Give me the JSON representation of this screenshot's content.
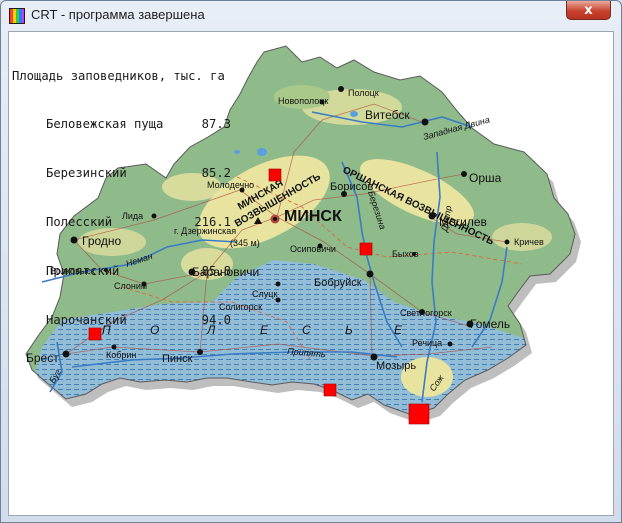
{
  "window": {
    "title": "CRT - программа завершена",
    "close_glyph": "x",
    "icon": "crt-program-icon"
  },
  "console": {
    "heading": "Площадь заповедников, тыс. га",
    "rows": [
      {
        "name": "Беловежская пуща",
        "value": "87.3"
      },
      {
        "name": "Березинский",
        "value": "85.2"
      },
      {
        "name": "Полесский",
        "value": "216.1"
      },
      {
        "name": "Припятский",
        "value": "85.8"
      },
      {
        "name": "Нарочанский",
        "value": "94.0"
      }
    ]
  },
  "map": {
    "colors": {
      "lowland": "#8fba8a",
      "upland": "#e8e4a0",
      "polesie": "#93bcd7",
      "rivers": "#3a7cc4",
      "marker": "#ff0000"
    },
    "cities": {
      "minsk": "МИНСК",
      "vitebsk": "Витебск",
      "polotsk": "Полоцк",
      "novopolotsk": "Новополоцк",
      "orsha": "Орша",
      "mogilev": "Могилев",
      "krichev": "Кричев",
      "bykhov": "Быхов",
      "borisov": "Борисов",
      "molodechno": "Молодечно",
      "lida": "Лида",
      "grodno": "Гродно",
      "volkovysk": "Волковыск",
      "slonim": "Слоним",
      "baranovichi": "Барановичи",
      "osipovichi": "Осиповичи",
      "bobruisk": "Бобруйск",
      "slutsk": "Слуцк",
      "soligorsk": "Солигорск",
      "svetlogorsk": "Светлогорск",
      "gomel": "Гомель",
      "rechitsa": "Речица",
      "mozyr": "Мозырь",
      "pinsk": "Пинск",
      "kobrin": "Кобрин",
      "brest": "Брест"
    },
    "features": {
      "minsk_upland": "МИНСКАЯ ВОЗВЫШЕННОСТЬ",
      "minsk_upland_l1": "МИНСКАЯ",
      "minsk_upland_l2": "ВОЗВЫШЕННОСТЬ",
      "orsha_upland": "ОРШАНСКАЯ ВОЗВЫШЕННОСТЬ",
      "dzerzhinskaya": "г. Дзержинская",
      "dzerzhinskaya_height": "(345 м)",
      "polesie_letters": [
        "П",
        "О",
        "Л",
        "Е",
        "С",
        "Ь",
        "Е"
      ]
    },
    "rivers": {
      "neman": "Неман",
      "berezina": "Березина",
      "pripyat": "Припять",
      "dnepr": "Днепр",
      "zapadnaya_dvina": "Западная Двина",
      "bug": "Буг",
      "sozh": "Сож"
    }
  }
}
